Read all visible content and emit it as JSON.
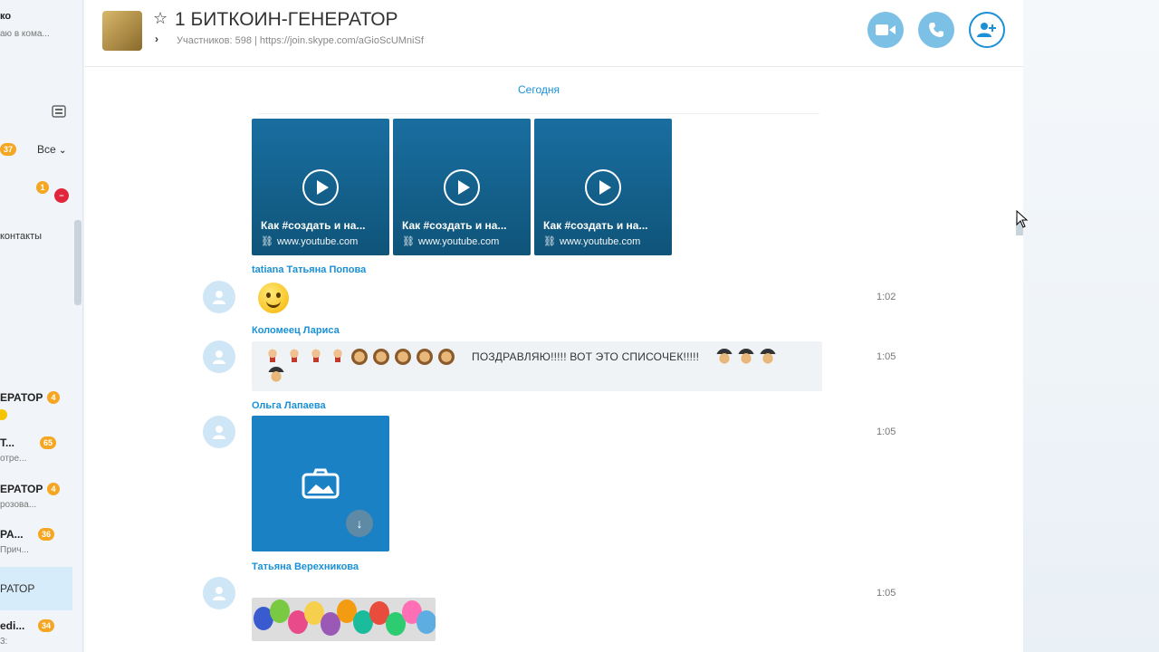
{
  "sidebar": {
    "snippet_top_name": "ко",
    "snippet_top_status": "аю в кома...",
    "badge_37": "37",
    "filter_label": "Все",
    "badge_1": "1",
    "contacts_label": "контакты",
    "items": [
      {
        "name": "ЕРАТОР",
        "badge": "4",
        "preview": ""
      },
      {
        "name": "Т...",
        "badge": "65",
        "preview": "отре..."
      },
      {
        "name": "ЕРАТОР",
        "badge": "4",
        "preview": "розова..."
      },
      {
        "name": "РА...",
        "badge": "36",
        "preview": "Прич..."
      },
      {
        "name": "РАТОР",
        "badge": "",
        "preview": ""
      },
      {
        "name": "edi...",
        "badge": "34",
        "preview": "3:"
      }
    ]
  },
  "header": {
    "title": "1 БИТКОИН-ГЕНЕРАТОР",
    "subtitle": "Участников: 598 | https://join.skype.com/aGioScUMniSf",
    "video_call_icon": "video-camera-icon",
    "audio_call_icon": "phone-icon",
    "add_people_icon": "add-person-icon"
  },
  "date_separator": "Сегодня",
  "videos": [
    {
      "title": "Как #создать и на...",
      "url": "www.youtube.com"
    },
    {
      "title": "Как #создать и на...",
      "url": "www.youtube.com"
    },
    {
      "title": "Как #создать и на...",
      "url": "www.youtube.com"
    }
  ],
  "messages": [
    {
      "sender": "tatiana Татьяна Попова",
      "time": "1:02"
    },
    {
      "sender": "Коломеец Лариса",
      "time": "1:05",
      "text": "ПОЗДРАВЛЯЮ!!!!! ВОТ ЭТО СПИСОЧЕК!!!!!"
    },
    {
      "sender": "Ольга Лапаева",
      "time": "1:05"
    },
    {
      "sender": "Татьяна Верехникова",
      "time": "1:05"
    }
  ],
  "colors": {
    "accent": "#1a90d6",
    "badge": "#f5a623",
    "card": "#196ea0"
  }
}
